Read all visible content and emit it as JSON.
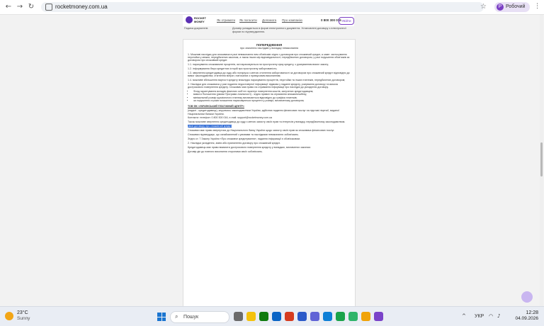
{
  "browser": {
    "url": "rocketmoney.com.ua",
    "profile_label": "Робочий",
    "profile_initial": "Р"
  },
  "site": {
    "logo_text": "ROCKET MONEY",
    "nav": [
      "Як отримати",
      "Як погасити",
      "Допомога",
      "Про компанію"
    ],
    "phone": "0 800 300 016",
    "login": "Увійти",
    "strip_left": "Подача документів",
    "strip_right": "Договір укладається в формі електронного документа. Установлені договору з електронної форми по підтвердженню."
  },
  "doc": {
    "title": "ПОПЕРЕДЖЕННЯ",
    "subtitle": "про значення наслідків у випадку невиконання",
    "paragraphs": [
      "1. Можливі наслідки для споживача в разі невиконання ним обов'язків згідно з договором про споживчий кредит, а саме: застосування неустойки у межах, передбачених законом, а також інших мір відповідальності, передбачених договором, у разі порушення обов'язків за договором про споживчий кредит.",
      "1.1. нарахування споживачеві процентів, які нараховуються на прострочену суму кредиту, з урахуванням вимог закону;",
      "1.2. інформування бюро кредитних історій про прострочену заборгованість;",
      "1.3. звернення кредитодавця до суду або нотаріуса з метою стягнення заборгованості за договором про споживчий кредит відповідно до вимог законодавства; стягнення витрат, пов'язаних з примусовим виконанням;",
      "1.4. можливе збільшення вартості кредиту внаслідок нарахування процентів, неустойки та інших платежів, передбачених договором;",
      "2. Наслідки для споживача у разі подання недостовірної інформації: відмова у наданні кредиту, розірвання договору та вимога дострокового повернення кредиту. Споживач має право на отримання інформації про наслідки до укладення договору."
    ],
    "bullets": [
      "Фонд гарантування вкладів фізичних осіб не гарантує повернення коштів, залучених кредитодавцем;",
      "вимоги Положення (умови Програми лояльності) - згідно правил на отримання знижки/кешбеку;",
      "мінімальний розмір щомісячного платежу визначається відповідно до графіка платежів;",
      "за порушення строків погашення нараховуються проценти у розмірі, визначеному договором;"
    ],
    "company": "ТОВ ФК «УКРАЇНСЬКИЙ ПЛАТІЖНИЙ ЦЕНТР»",
    "paragraphs2": [
      "(надалі - кредитодавець), керуючись законодавством України, здійснює надання фінансових послуг на підставі ліцензії, виданої Національним банком України.",
      "Контакти: телефон: 0 800 300 016, e-mail: support@rocketmoney.com.ua",
      "Також можливе звернення кредитодавця до суду з метою захисту своїх прав та інтересів у випадку, передбаченому законодавством.",
      "Споживач має право звернутися до Національного банку України щодо захисту своїх прав як споживача фінансових послуг.",
      "Споживач підтверджує, що ознайомлений з умовами та наслідками невиконання зобов'язань.",
      "Згідно ст. 7 Закону України «Про споживче кредитування», надання інформації є обов'язковим.",
      "2. Наслідки укладення, зміни або припинення договору про споживчий кредит.",
      "Кредитодавець має право вимагати дострокового повернення кредиту у випадках, визначених законом.",
      "Договір діє до повного виконання сторонами своїх зобов'язань."
    ],
    "highlight": "умов договору про споживчий кредит"
  },
  "taskbar": {
    "temp": "23°C",
    "weather": "Sunny",
    "search": "Пошук",
    "lang": "УКР",
    "time": "12:28",
    "date": "04.09.2026"
  }
}
